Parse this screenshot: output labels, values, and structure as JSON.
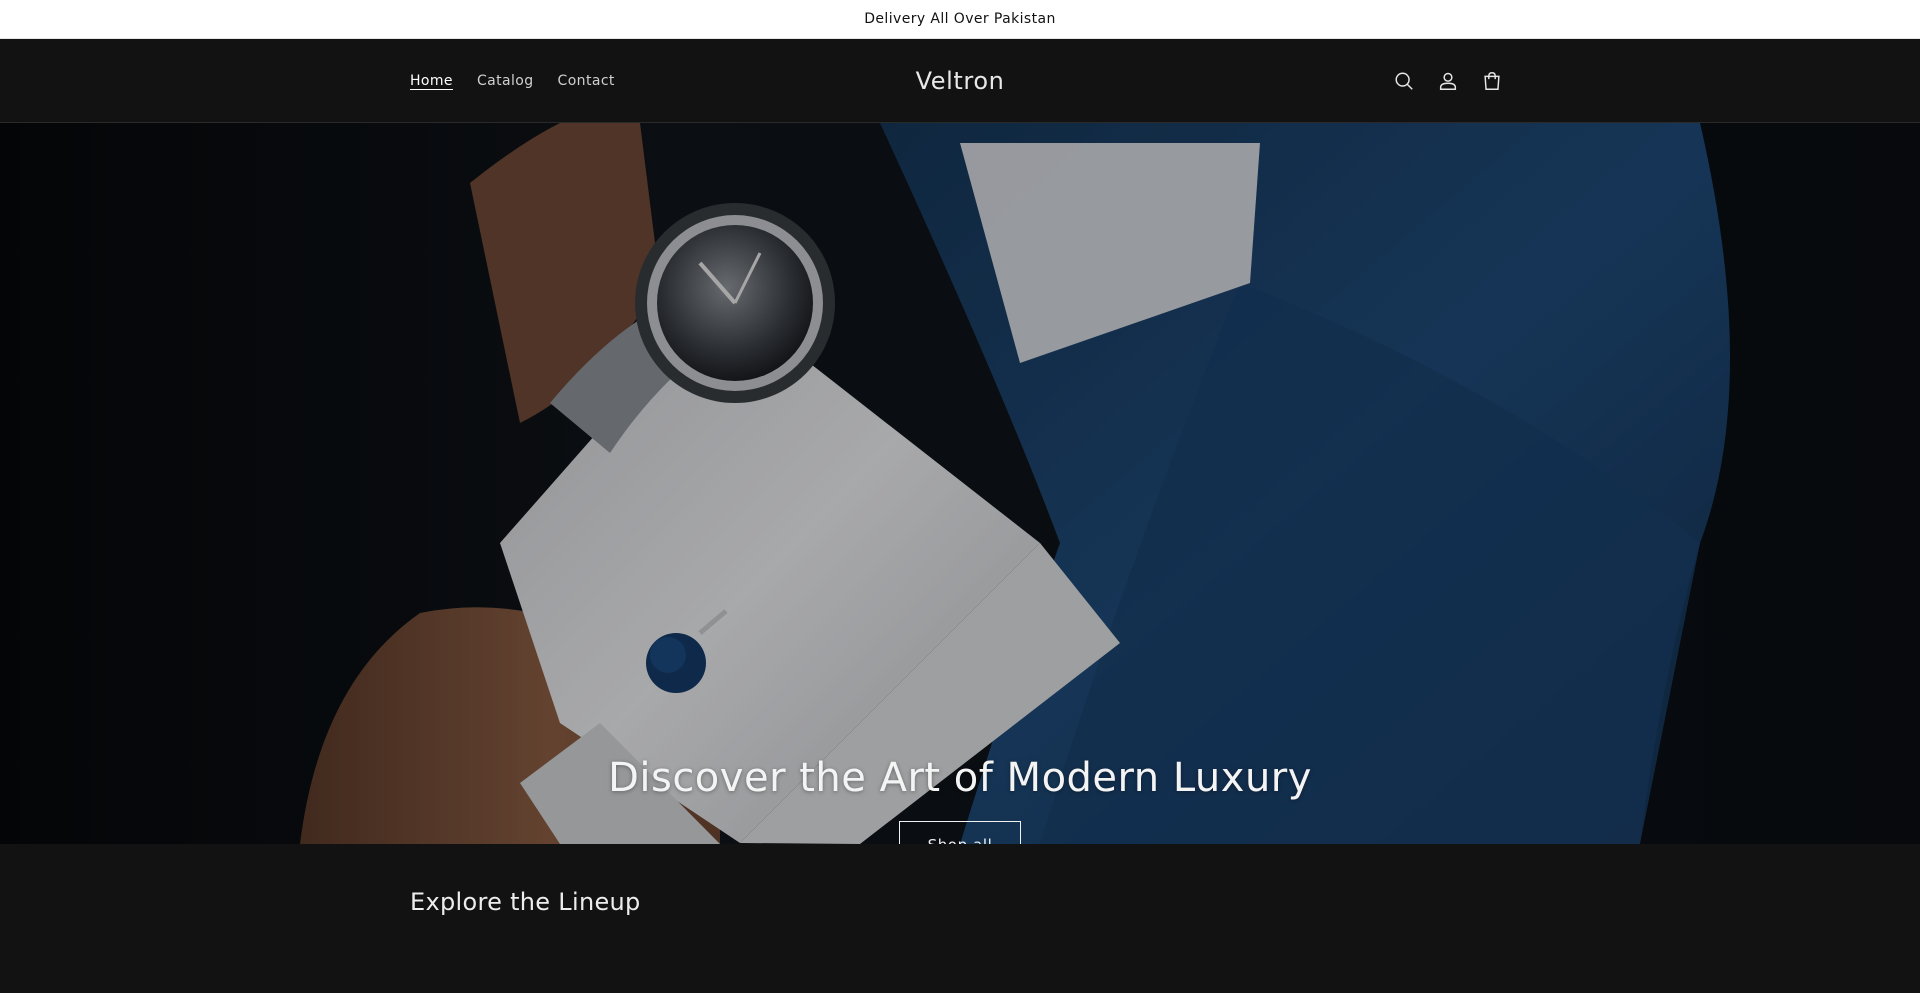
{
  "announcement": {
    "text": "Delivery All Over Pakistan"
  },
  "header": {
    "logo": "Veltron",
    "nav": [
      {
        "label": "Home",
        "active": true
      },
      {
        "label": "Catalog",
        "active": false
      },
      {
        "label": "Contact",
        "active": false
      }
    ],
    "icons": [
      "search-icon",
      "account-icon",
      "cart-icon"
    ]
  },
  "hero": {
    "title": "Discover the Art of Modern Luxury",
    "button_label": "Shop all"
  },
  "section": {
    "title": "Explore the Lineup"
  },
  "colors": {
    "header_bg": "#121212",
    "announcement_bg": "#ffffff",
    "suit_blue": "#1f4a78",
    "shirt_white": "#e9eaec"
  }
}
